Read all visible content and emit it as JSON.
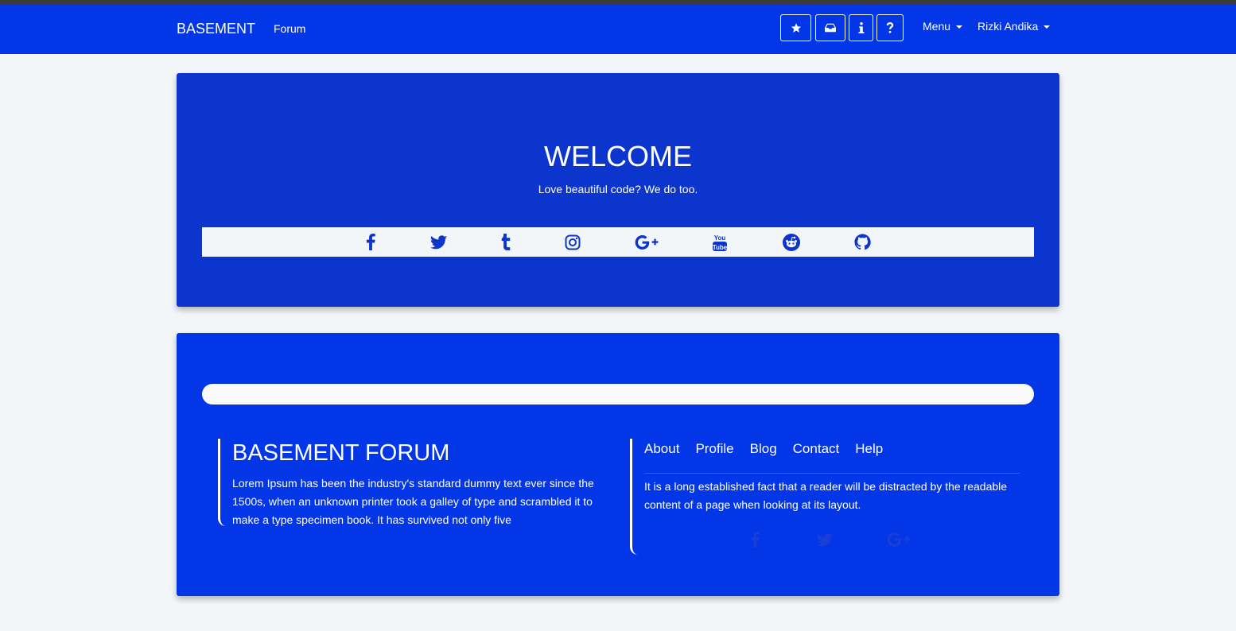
{
  "navbar": {
    "brand": "BASEMENT",
    "forum_link": "Forum",
    "icon_buttons": [
      "star-icon",
      "inbox-icon",
      "info-icon",
      "question-icon"
    ],
    "menu_label": "Menu",
    "user_label": "Rizki Andika",
    "background": "#0236e6"
  },
  "hero": {
    "title": "WELCOME",
    "tagline": "Love beautiful code? We do too.",
    "social_icons": [
      "facebook-icon",
      "twitter-icon",
      "tumblr-icon",
      "instagram-icon",
      "google-plus-icon",
      "youtube-icon",
      "reddit-icon",
      "github-icon"
    ],
    "background": "#0b35cd"
  },
  "footer": {
    "title": "BASEMENT FORUM",
    "description": "Lorem Ipsum has been the industry's standard dummy text ever since the 1500s, when an unknown printer took a galley of type and scrambled it to make a type specimen book. It has survived not only five",
    "links": [
      "About",
      "Profile",
      "Blog",
      "Contact",
      "Help"
    ],
    "note": "It is a long established fact that a reader will be distracted by the readable content of a page when looking at its layout.",
    "social_icons": [
      "facebook-icon",
      "twitter-icon",
      "google-plus-icon"
    ],
    "background": "#0236e6"
  }
}
